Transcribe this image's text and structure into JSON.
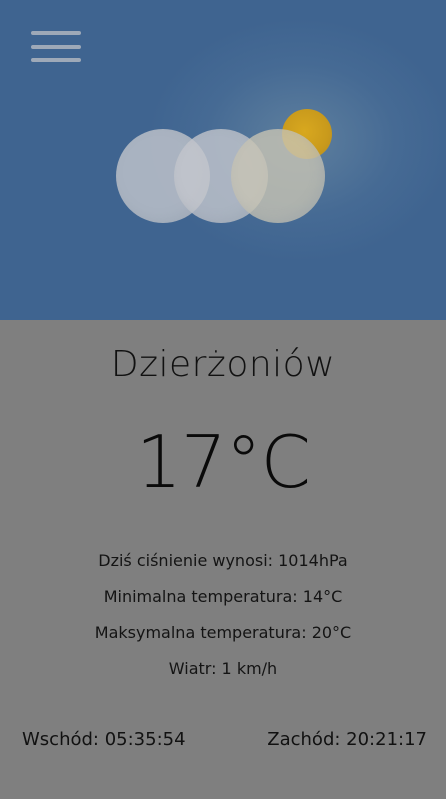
{
  "header": {
    "menu_icon": "hamburger-menu-icon",
    "weather_icon": "partly-cloudy-icon"
  },
  "weather": {
    "city": "Dzierżoniów",
    "temperature": "17°C",
    "pressure": "Dziś ciśnienie wynosi: 1014hPa",
    "min_temp": "Minimalna temperatura: 14°C",
    "max_temp": "Maksymalna temperatura: 20°C",
    "wind": "Wiatr: 1 km/h"
  },
  "sun": {
    "sunrise": "Wschód: 05:35:54",
    "sunset": "Zachód: 20:21:17"
  },
  "colors": {
    "hero_background": "#3f6490",
    "content_background": "#7f7f7f",
    "sun": "#d8a81f",
    "cloud": "#c4c7cd",
    "text": "#111111"
  }
}
